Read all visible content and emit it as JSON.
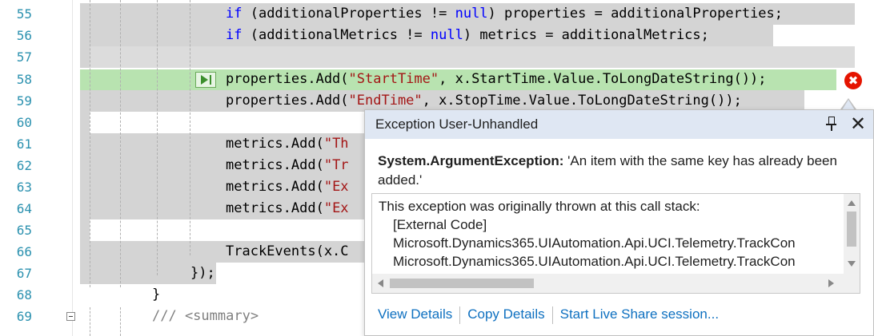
{
  "editor": {
    "lines": [
      {
        "num": "55",
        "segments": [
          {
            "t": "if",
            "c": "kw"
          },
          {
            "t": " (additionalProperties != ",
            "c": ""
          },
          {
            "t": "null",
            "c": "kw"
          },
          {
            "t": ") properties = additionalProperties;",
            "c": ""
          }
        ]
      },
      {
        "num": "56",
        "segments": [
          {
            "t": "if",
            "c": "kw"
          },
          {
            "t": " (additionalMetrics != ",
            "c": ""
          },
          {
            "t": "null",
            "c": "kw"
          },
          {
            "t": ") metrics = additionalMetrics;",
            "c": ""
          }
        ]
      },
      {
        "num": "57",
        "segments": []
      },
      {
        "num": "58",
        "segments": [
          {
            "t": "properties.Add(",
            "c": ""
          },
          {
            "t": "\"StartTime\"",
            "c": "str"
          },
          {
            "t": ", x.StartTime.Value.ToLongDateString());",
            "c": ""
          }
        ]
      },
      {
        "num": "59",
        "segments": [
          {
            "t": "properties.Add(",
            "c": ""
          },
          {
            "t": "\"EndTime\"",
            "c": "str"
          },
          {
            "t": ", x.StopTime.Value.ToLongDateString());",
            "c": ""
          }
        ]
      },
      {
        "num": "60",
        "segments": []
      },
      {
        "num": "61",
        "segments": [
          {
            "t": "metrics.Add(",
            "c": ""
          },
          {
            "t": "\"Th",
            "c": "str"
          }
        ]
      },
      {
        "num": "62",
        "segments": [
          {
            "t": "metrics.Add(",
            "c": ""
          },
          {
            "t": "\"Tr",
            "c": "str"
          }
        ]
      },
      {
        "num": "63",
        "segments": [
          {
            "t": "metrics.Add(",
            "c": ""
          },
          {
            "t": "\"Ex",
            "c": "str"
          }
        ]
      },
      {
        "num": "64",
        "segments": [
          {
            "t": "metrics.Add(",
            "c": ""
          },
          {
            "t": "\"Ex",
            "c": "str"
          }
        ]
      },
      {
        "num": "65",
        "segments": []
      },
      {
        "num": "66",
        "segments": [
          {
            "t": "TrackEvents(x.C",
            "c": ""
          }
        ]
      },
      {
        "num": "67",
        "segments": [
          {
            "t": "});",
            "c": ""
          }
        ]
      },
      {
        "num": "68",
        "segments": [
          {
            "t": "}",
            "c": ""
          }
        ]
      },
      {
        "num": "69",
        "segments": [
          {
            "t": "/// <summary>",
            "c": "cm"
          }
        ]
      }
    ]
  },
  "error_glyph": "✖",
  "popup": {
    "title": "Exception User-Unhandled",
    "pin_icon": "pin-icon",
    "close_icon": "close-icon",
    "exception_type": "System.ArgumentException:",
    "exception_message": " 'An item with the same key has already been added.'",
    "stack_header": "This exception was originally thrown at this call stack:",
    "stack_items": [
      "[External Code]",
      "Microsoft.Dynamics365.UIAutomation.Api.UCI.Telemetry.TrackCon",
      "Microsoft.Dynamics365.UIAutomation.Api.UCI.Telemetry.TrackCon"
    ],
    "links": {
      "view_details": "View Details",
      "copy_details": "Copy Details",
      "live_share": "Start Live Share session..."
    }
  },
  "colors": {
    "line_number": "#2b91af",
    "keyword": "#0000ff",
    "string": "#a31515",
    "selection": "#d4d4d4",
    "current_statement": "#b8e3b0",
    "error": "#e51400",
    "link": "#0e70c0"
  }
}
